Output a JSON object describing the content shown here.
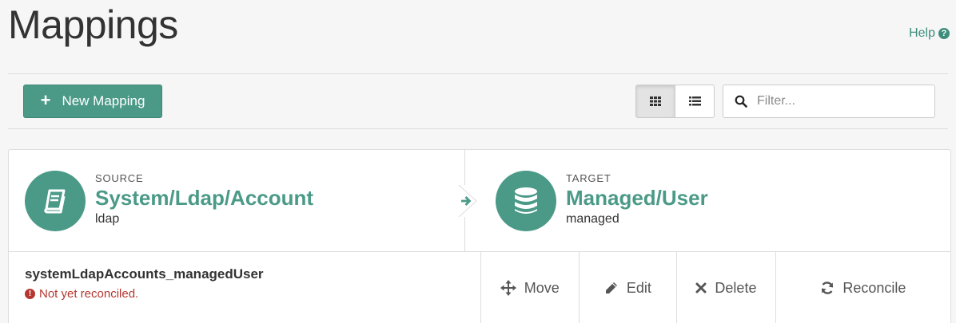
{
  "page": {
    "title": "Mappings",
    "help_label": "Help",
    "help_icon": "question-circle-icon"
  },
  "toolbar": {
    "new_mapping_label": "New Mapping",
    "filter_placeholder": "Filter...",
    "filter_value": "",
    "view_mode_selected": "grid"
  },
  "mapping": {
    "source": {
      "label": "SOURCE",
      "name": "System/Ldap/Account",
      "sub": "ldap",
      "icon": "book-icon"
    },
    "target": {
      "label": "TARGET",
      "name": "Managed/User",
      "sub": "managed",
      "icon": "database-icon"
    },
    "name": "systemLdapAccounts_managedUser",
    "status": "Not yet reconciled.",
    "actions": {
      "move": "Move",
      "edit": "Edit",
      "delete": "Delete",
      "reconcile": "Reconcile"
    }
  },
  "colors": {
    "accent": "#4b9a88",
    "error": "#b5372f",
    "background": "#f6f6f6"
  }
}
